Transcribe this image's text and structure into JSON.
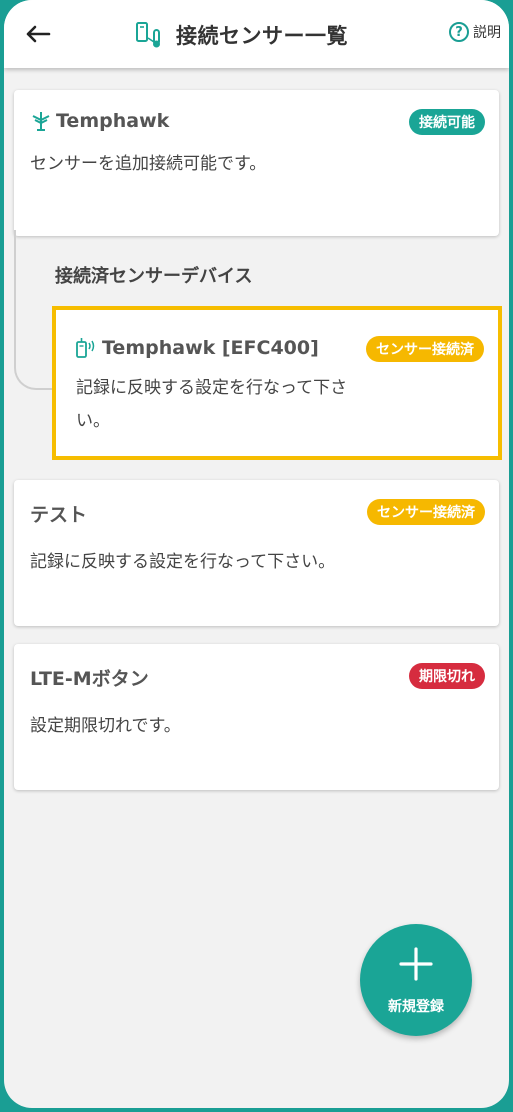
{
  "header": {
    "title": "接続センサー一覧",
    "help_label": "説明",
    "help_glyph": "?",
    "back_glyph": "←"
  },
  "gateway_card": {
    "name": "Temphawk",
    "status": "接続可能",
    "description": "センサーを追加接続可能です。"
  },
  "connected_section": {
    "heading": "接続済センサーデバイス",
    "device": {
      "name": "Temphawk [EFC400]",
      "status": "センサー接続済",
      "description_line1": "記録に反映する設定を行なって下さ",
      "description_line2": "い。"
    }
  },
  "cards": [
    {
      "name": "テスト",
      "status": "センサー接続済",
      "description": "記録に反映する設定を行なって下さい。"
    },
    {
      "name": "LTE-Mボタン",
      "status": "期限切れ",
      "description": "設定期限切れです。"
    }
  ],
  "fab": {
    "label": "新規登録"
  },
  "colors": {
    "accent": "#1aa596",
    "warning": "#f6b800",
    "error": "#d62c3f",
    "highlight_border": "#f6bd00"
  }
}
